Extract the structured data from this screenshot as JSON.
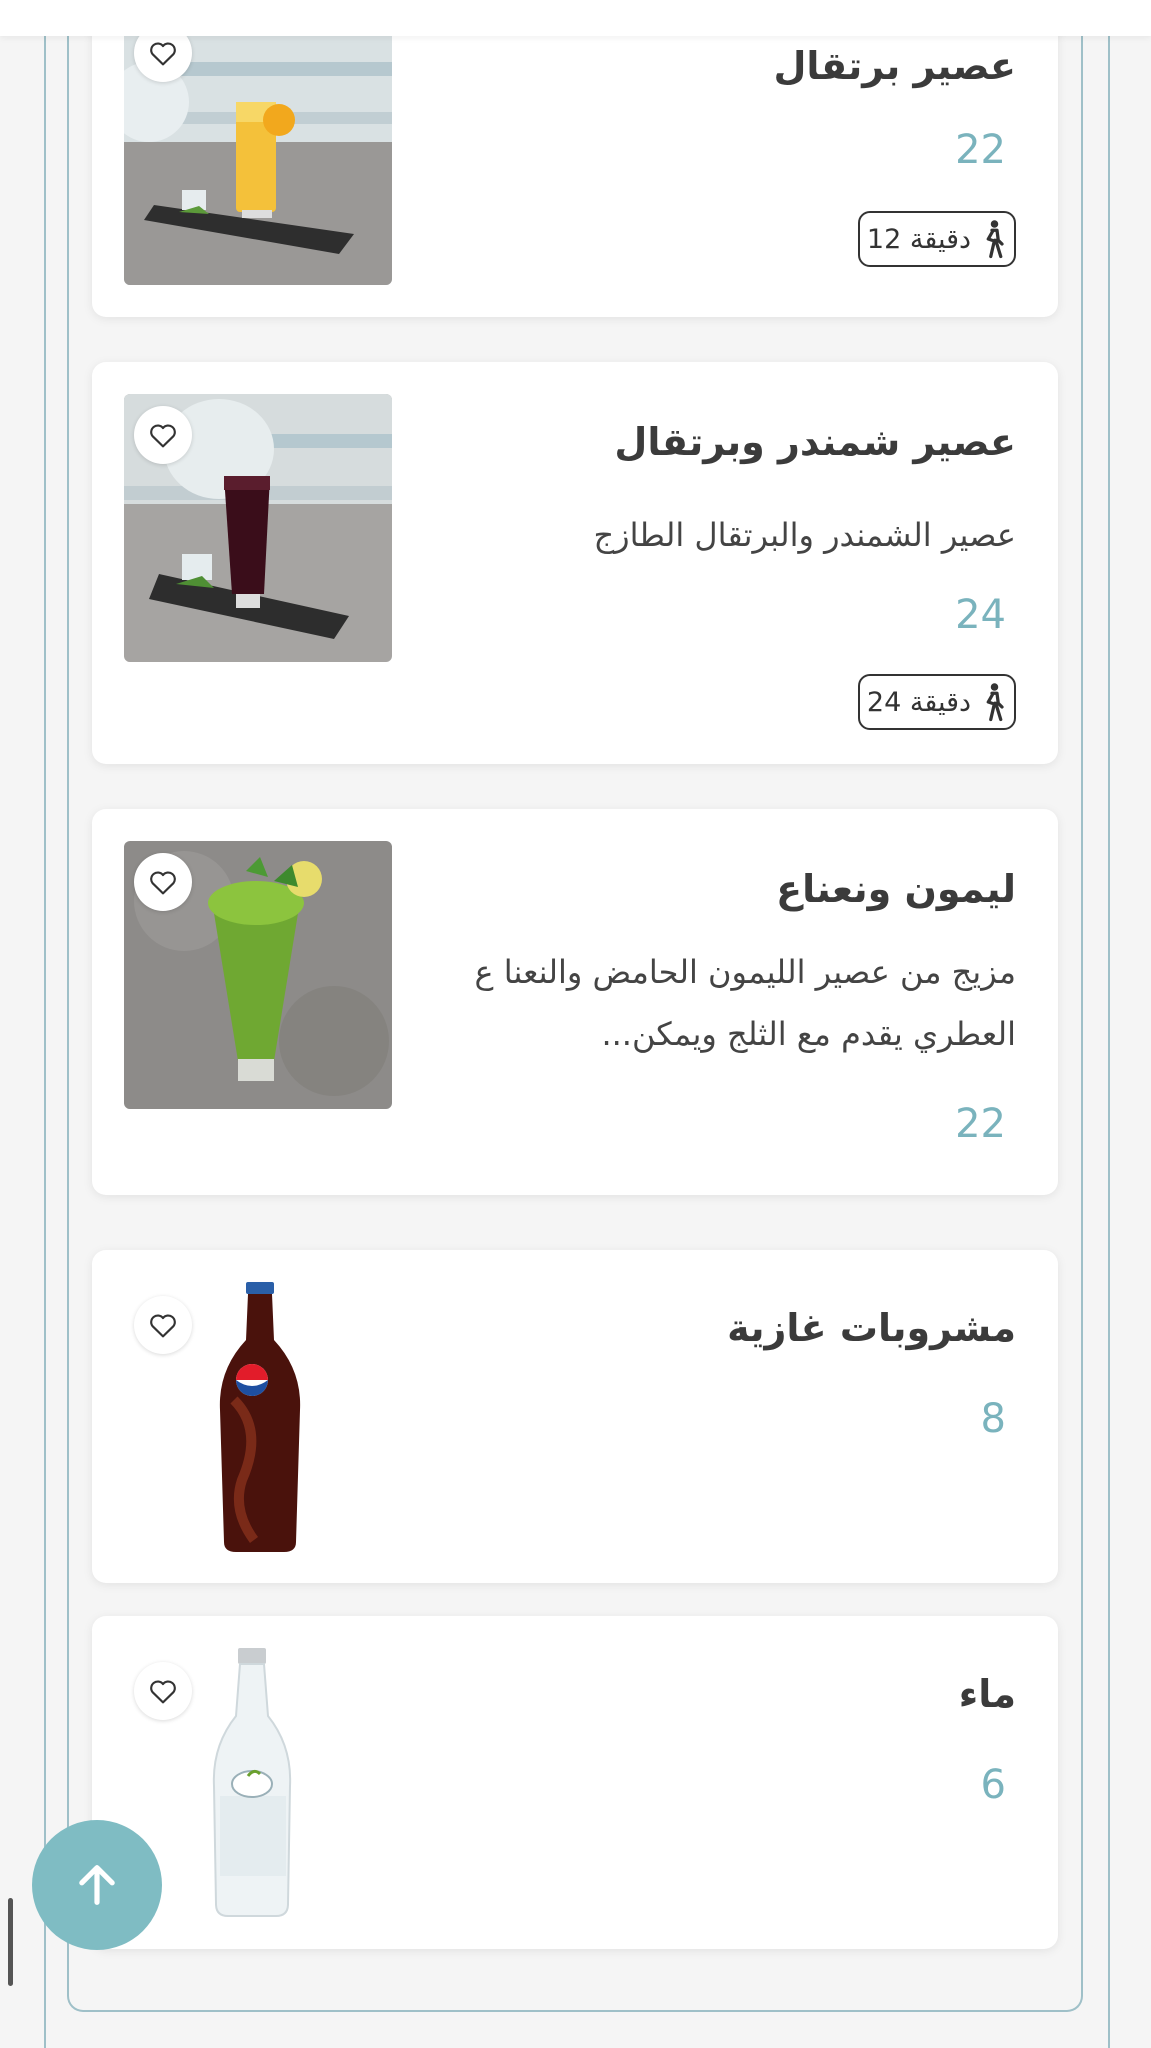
{
  "theme": {
    "accent": "#7ab3bd",
    "frame": "#9fc0c8",
    "scroll_button": "#7fbcc3",
    "text": "#3b3b3b"
  },
  "menu": {
    "items": [
      {
        "name": "عصير برتقال",
        "price": "22",
        "prep_time": "12 دقيقة",
        "icons": [
          "heart-icon",
          "walking-person-icon"
        ]
      },
      {
        "name": "عصير شمندر وبرتقال",
        "description": "عصير الشمندر والبرتقال الطازج",
        "price": "24",
        "prep_time": "24 دقيقة",
        "icons": [
          "heart-icon",
          "walking-person-icon"
        ]
      },
      {
        "name": "ليمون ونعناع",
        "description": "مزيج من عصير الليمون الحامض والنعنا ع العطري يقدم مع الثلج ويمكن...",
        "price": "22",
        "icons": [
          "heart-icon"
        ]
      },
      {
        "name": "مشروبات غازية",
        "price": "8",
        "icons": [
          "heart-icon"
        ]
      },
      {
        "name": "ماء",
        "price": "6",
        "icons": [
          "heart-icon"
        ]
      }
    ]
  },
  "scroll_top_icon": "arrow-up-icon"
}
